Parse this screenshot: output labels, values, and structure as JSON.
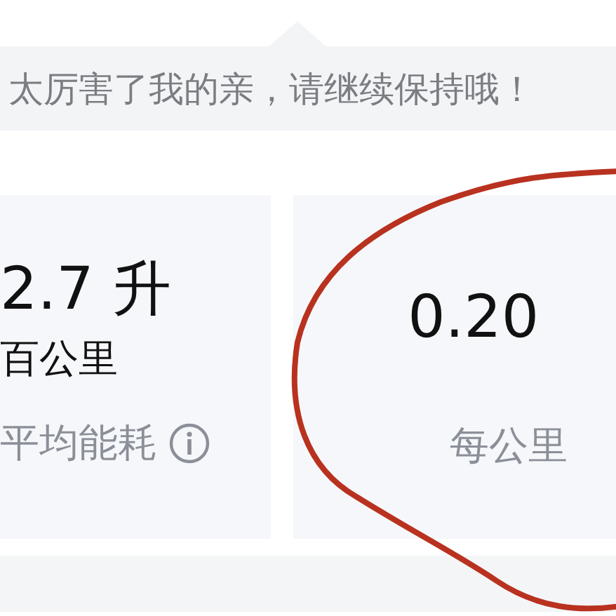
{
  "tip": {
    "text": "太厉害了我的亲，请继续保持哦！"
  },
  "cards": [
    {
      "value": "2.7 升",
      "unit": "百公里",
      "label": "平均能耗",
      "info": true
    },
    {
      "value": "0.20",
      "label": "每公里",
      "info": false
    }
  ]
}
